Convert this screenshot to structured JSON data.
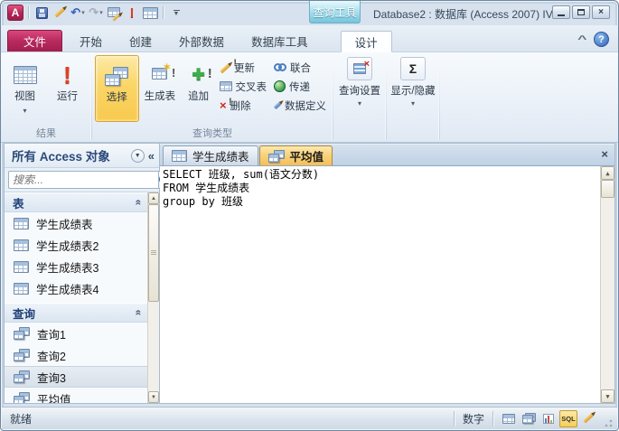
{
  "window": {
    "title": "Database2 : 数据库 (Access 2007) IV",
    "contextual_group": "查询工具"
  },
  "ribbon": {
    "tabs": [
      {
        "label": "文件"
      },
      {
        "label": "开始"
      },
      {
        "label": "创建"
      },
      {
        "label": "外部数据"
      },
      {
        "label": "数据库工具"
      },
      {
        "label": "设计"
      }
    ],
    "results_group": {
      "label": "结果",
      "view": "视图",
      "run": "运行"
    },
    "query_type_group": {
      "label": "查询类型",
      "select": "选择",
      "make_table": "生成表",
      "append": "追加",
      "update": "更新",
      "crosstab": "交叉表",
      "delete": "删除",
      "union": "联合",
      "pass_through": "传递",
      "data_definition": "数据定义"
    },
    "query_setup": "查询设置",
    "show_hide": "显示/隐藏"
  },
  "nav": {
    "header": "所有 Access 对象",
    "search_placeholder": "搜索...",
    "sections": [
      {
        "title": "表",
        "items": [
          "学生成绩表",
          "学生成绩表2",
          "学生成绩表3",
          "学生成绩表4"
        ]
      },
      {
        "title": "查询",
        "items": [
          "查询1",
          "查询2",
          "查询3",
          "平均值"
        ]
      }
    ]
  },
  "doc": {
    "tabs": [
      {
        "label": "学生成绩表"
      },
      {
        "label": "平均值"
      }
    ],
    "sql_lines": [
      "SELECT 班级, sum(语文分数)",
      "FROM 学生成绩表",
      "group by 班级"
    ]
  },
  "status": {
    "ready": "就绪",
    "num_lock": "数字",
    "sql_badge": "SQL"
  }
}
